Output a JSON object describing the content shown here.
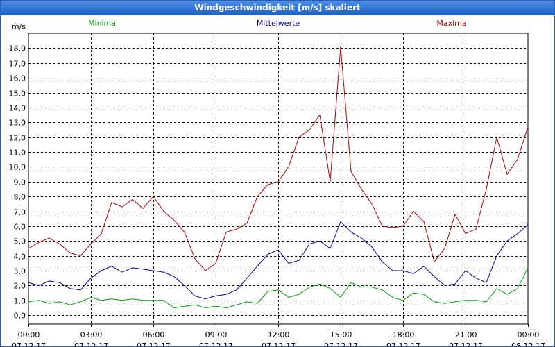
{
  "window": {
    "title": "Windgeschwindigkeit [m/s] skaliert"
  },
  "colors": {
    "minima": "#00a000",
    "mittelwerte": "#0000a0",
    "maxima": "#b00000",
    "title_bar": "#1f5fc4"
  },
  "chart_data": {
    "type": "line",
    "title": "Windgeschwindigkeit [m/s] skaliert",
    "ylabel": "m/s",
    "ylim": [
      -0.6,
      19
    ],
    "yticks": [
      "0,0",
      "1,0",
      "2,0",
      "3,0",
      "4,0",
      "5,0",
      "6,0",
      "7,0",
      "8,0",
      "9,0",
      "10,0",
      "11,0",
      "12,0",
      "13,0",
      "14,0",
      "15,0",
      "16,0",
      "17,0",
      "18,0"
    ],
    "xticks": [
      {
        "time": "00:00",
        "date": "07.12.17"
      },
      {
        "time": "03:00",
        "date": "07.12.17"
      },
      {
        "time": "06:00",
        "date": "07.12.17"
      },
      {
        "time": "09:00",
        "date": "07.12.17"
      },
      {
        "time": "12:00",
        "date": "07.12.17"
      },
      {
        "time": "15:00",
        "date": "07.12.17"
      },
      {
        "time": "18:00",
        "date": "07.12.17"
      },
      {
        "time": "21:00",
        "date": "07.12.17"
      },
      {
        "time": "00:00",
        "date": "08.12.17"
      }
    ],
    "x_hours": [
      0,
      0.5,
      1,
      1.5,
      2,
      2.5,
      3,
      3.5,
      4,
      4.5,
      5,
      5.5,
      6,
      6.5,
      7,
      7.5,
      8,
      8.5,
      9,
      9.5,
      10,
      10.5,
      11,
      11.5,
      12,
      12.5,
      13,
      13.5,
      14,
      14.5,
      15,
      15.5,
      16,
      16.5,
      17,
      17.5,
      18,
      18.5,
      19,
      19.5,
      20,
      20.5,
      21,
      21.5,
      22,
      22.5,
      23,
      23.5,
      24
    ],
    "grid": true,
    "legend": "top",
    "series": [
      {
        "name": "Minima",
        "values": [
          0.9,
          1.0,
          0.8,
          0.9,
          0.7,
          0.9,
          1.2,
          1.0,
          1.1,
          1.0,
          1.1,
          1.0,
          1.0,
          1.0,
          0.5,
          0.6,
          0.7,
          0.5,
          0.6,
          0.5,
          0.7,
          0.9,
          0.8,
          1.6,
          1.7,
          1.2,
          1.4,
          1.9,
          2.1,
          1.8,
          1.2,
          2.2,
          1.9,
          1.9,
          1.7,
          1.2,
          1.0,
          1.5,
          1.4,
          0.9,
          0.8,
          0.9,
          1.0,
          1.0,
          0.9,
          1.8,
          1.4,
          1.8,
          3.2
        ]
      },
      {
        "name": "Mittelwerte",
        "values": [
          2.2,
          2.0,
          2.3,
          2.2,
          1.8,
          1.7,
          2.5,
          3.0,
          3.3,
          2.9,
          3.2,
          3.1,
          3.0,
          2.9,
          2.6,
          2.0,
          1.3,
          1.1,
          1.3,
          1.4,
          1.7,
          2.5,
          3.3,
          4.1,
          4.4,
          3.5,
          3.7,
          4.8,
          5.0,
          4.5,
          6.3,
          5.6,
          5.2,
          4.6,
          3.6,
          3.0,
          3.0,
          2.8,
          3.3,
          2.6,
          2.0,
          2.1,
          3.0,
          2.5,
          2.2,
          4.0,
          5.0,
          5.5,
          6.1
        ]
      },
      {
        "name": "Maxima",
        "values": [
          4.5,
          4.9,
          5.2,
          4.8,
          4.2,
          4.0,
          4.8,
          5.5,
          7.6,
          7.3,
          7.8,
          7.2,
          8.0,
          7.0,
          6.4,
          5.6,
          3.8,
          3.0,
          3.5,
          5.6,
          5.8,
          6.2,
          8.0,
          8.8,
          9.0,
          10.0,
          12.0,
          12.5,
          13.5,
          9.0,
          18.1,
          9.7,
          8.5,
          7.5,
          6.0,
          5.9,
          6.0,
          7.0,
          6.3,
          3.6,
          4.5,
          6.8,
          5.5,
          5.8,
          8.5,
          12.0,
          9.5,
          10.5,
          12.7
        ]
      }
    ]
  }
}
